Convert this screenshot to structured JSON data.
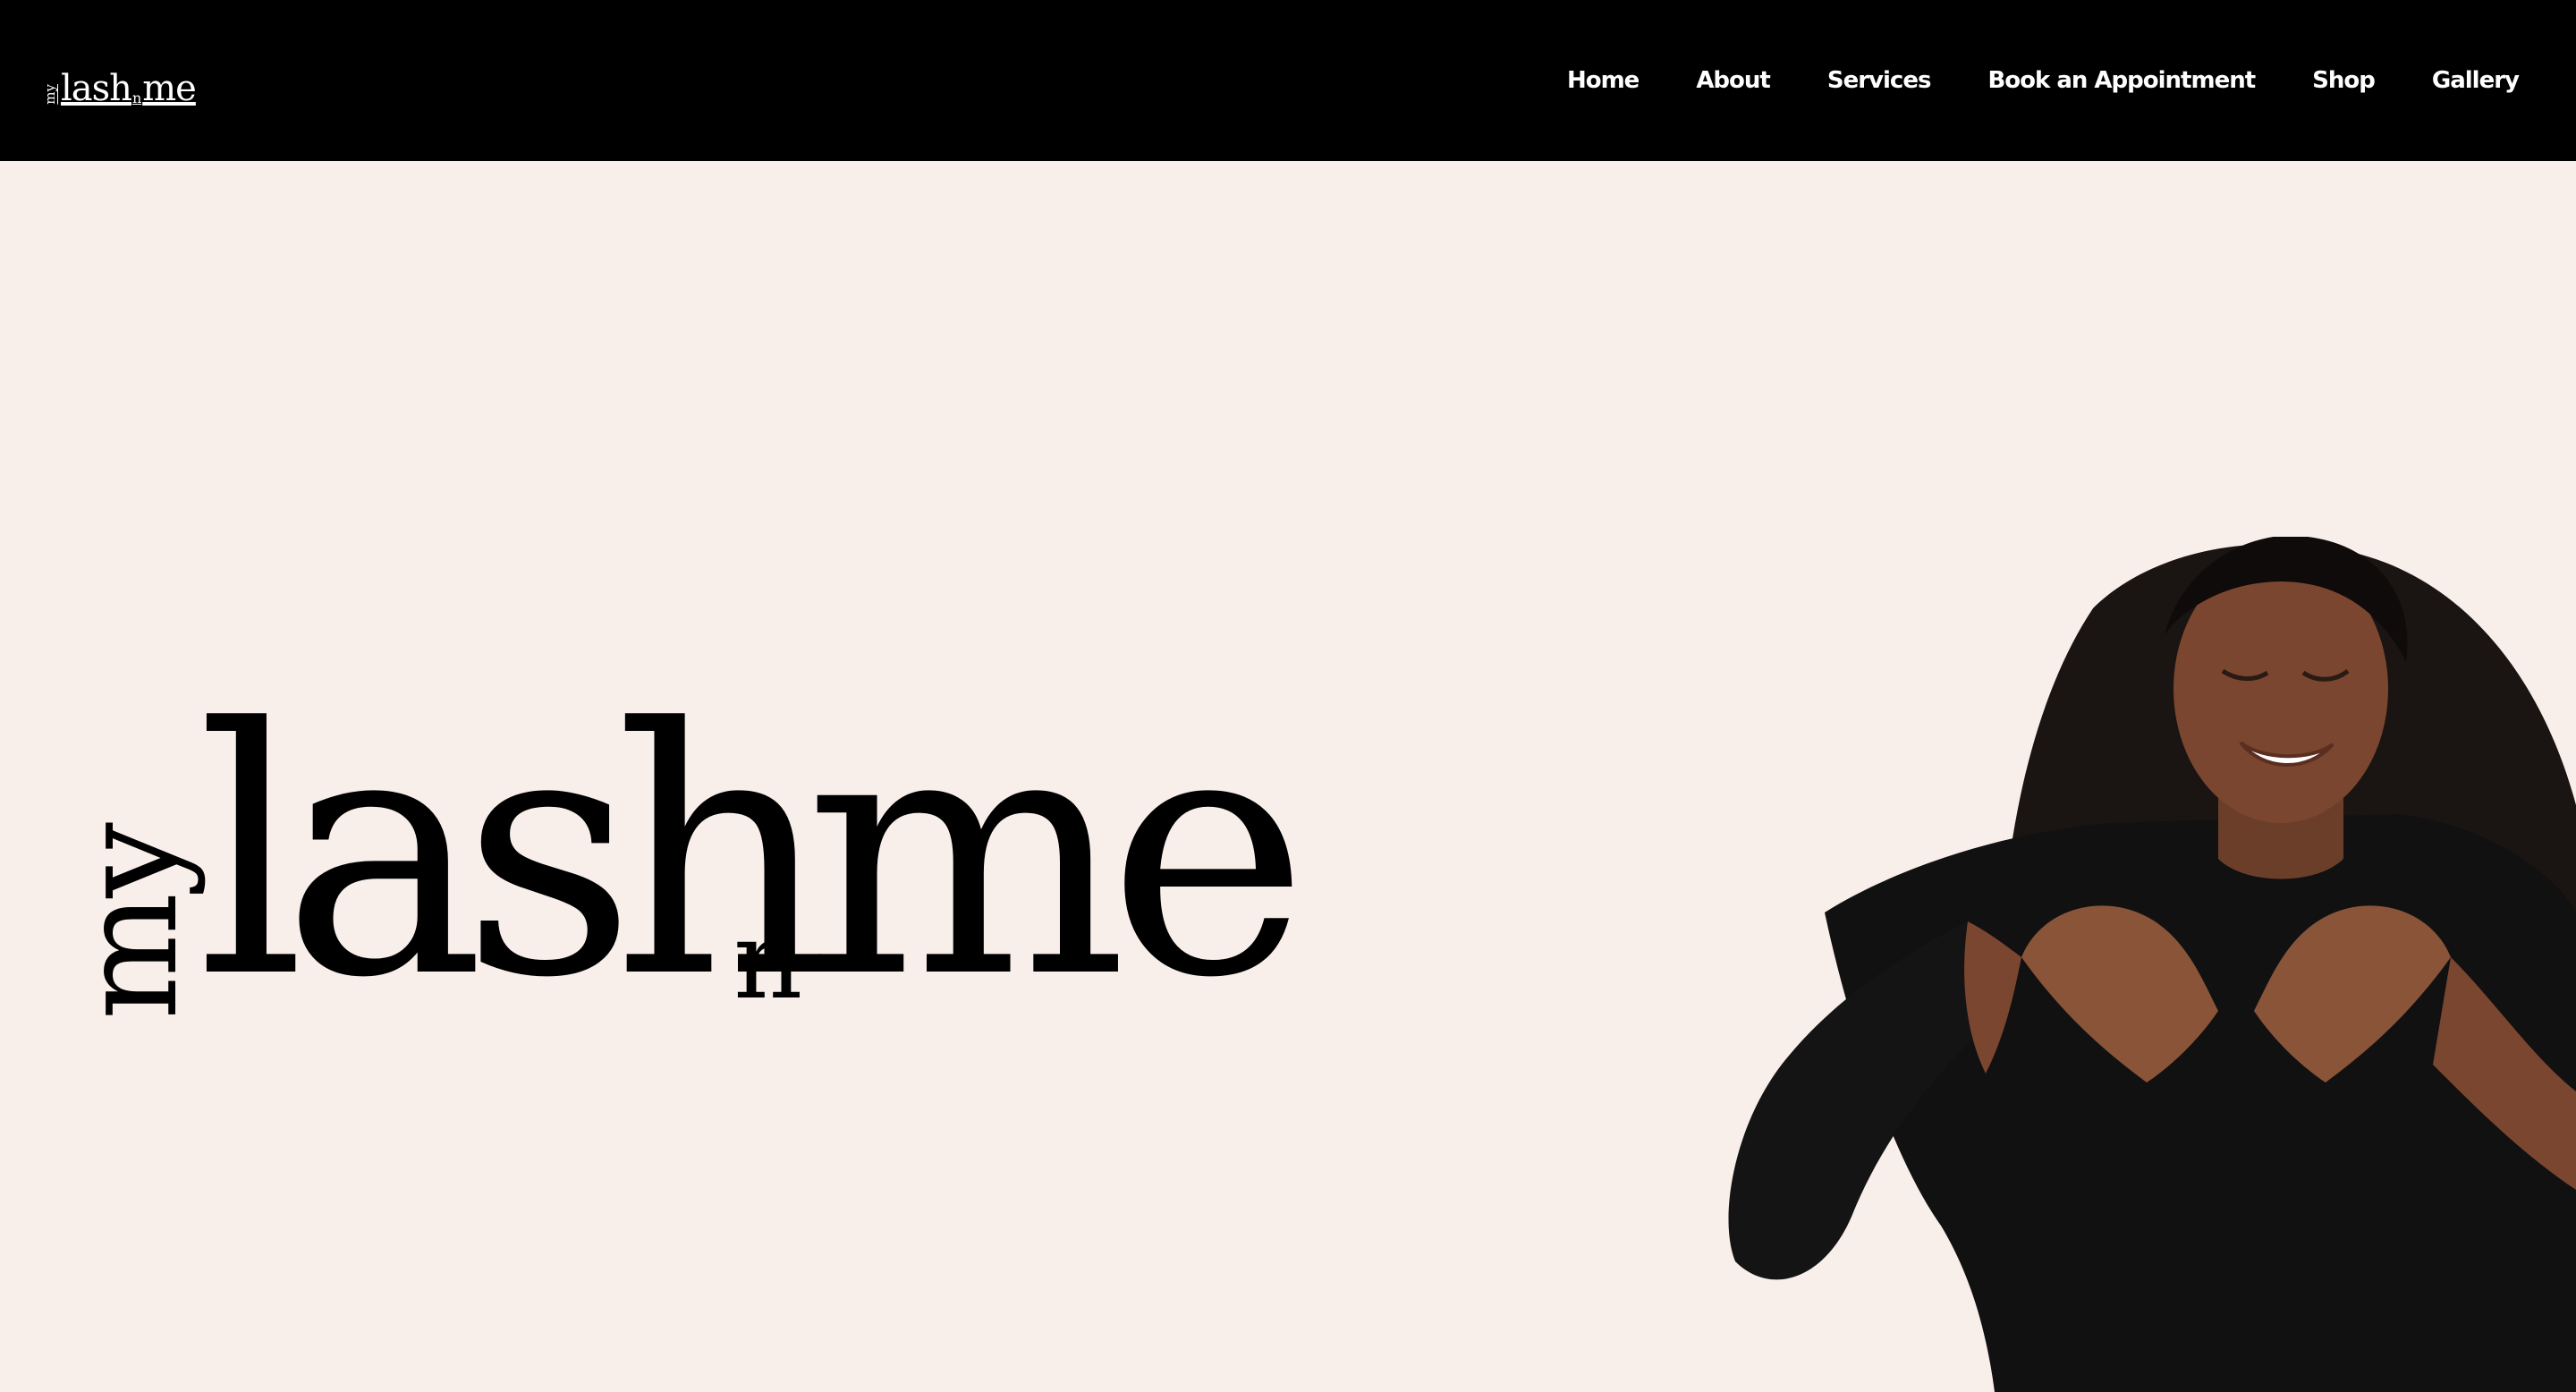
{
  "brand": {
    "logo_parts": {
      "my": "my",
      "lash": "lash",
      "n": "n",
      "me": "me"
    }
  },
  "nav": {
    "items": [
      {
        "label": "Home"
      },
      {
        "label": "About"
      },
      {
        "label": "Services"
      },
      {
        "label": "Book an Appointment"
      },
      {
        "label": "Shop"
      },
      {
        "label": "Gallery"
      }
    ]
  },
  "hero": {
    "wordmark": {
      "my": "my",
      "lash": "lash",
      "n": "n",
      "me": "me"
    },
    "image": {
      "subject": "woman making heart hands"
    }
  },
  "colors": {
    "header_bg": "#000000",
    "page_bg": "#f8efeb",
    "nav_text": "#ffffff",
    "wordmark": "#000000"
  }
}
